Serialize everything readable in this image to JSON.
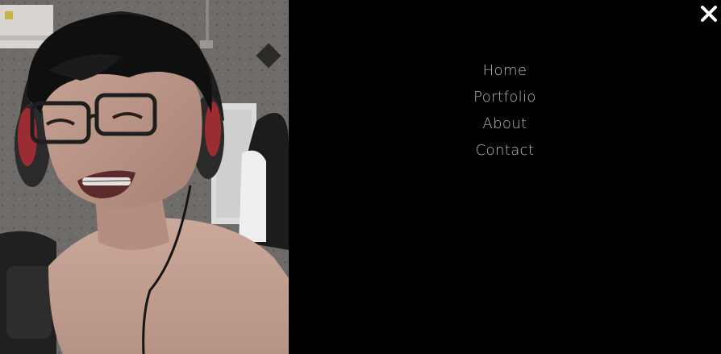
{
  "menu": {
    "items": [
      {
        "label": "Home"
      },
      {
        "label": "Portfolio"
      },
      {
        "label": "About"
      },
      {
        "label": "Contact"
      }
    ],
    "text_color": "#b9b9b9",
    "background": "#000000"
  },
  "close_button": {
    "icon": "close-icon",
    "color": "#ffffff"
  },
  "photo": {
    "subject": "portrait-photo"
  }
}
